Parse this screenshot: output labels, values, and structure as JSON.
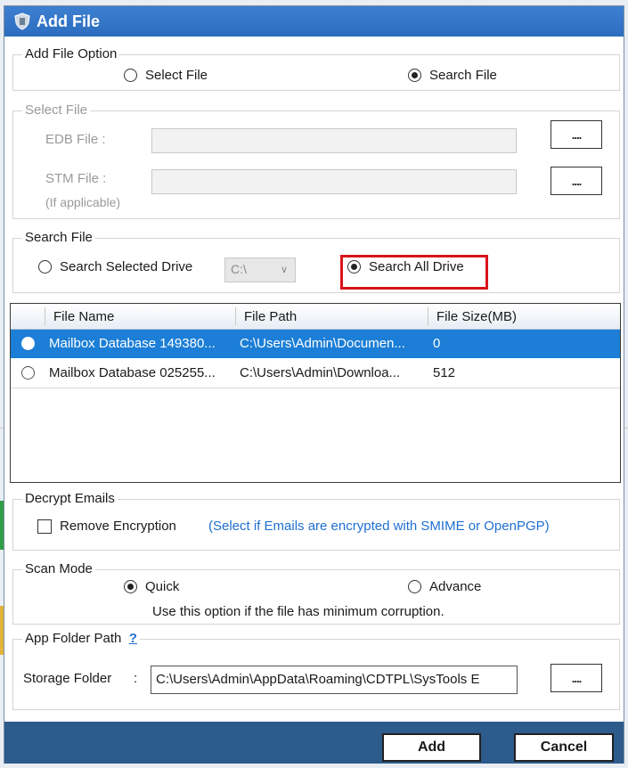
{
  "dialog": {
    "title": "Add File",
    "colors": {
      "titlebar": "#2c6dbf",
      "footer": "#2d5b8c",
      "selection": "#1c7ed6",
      "highlight": "#d9141b",
      "hint": "#1f6fd1"
    }
  },
  "add_file_option": {
    "title": "Add File Option",
    "options": [
      {
        "label": "Select File",
        "selected": false
      },
      {
        "label": "Search File",
        "selected": true
      }
    ]
  },
  "select_file": {
    "title": "Select File",
    "edb_label": "EDB File :",
    "stm_label": "STM File :",
    "stm_note": "(If applicable)",
    "browse_label": "...."
  },
  "search_file": {
    "title": "Search File",
    "selected_drive_label": "Search Selected Drive",
    "drive_value": "C:\\",
    "all_drive_label": "Search All Drive",
    "selected_mode": "all"
  },
  "file_grid": {
    "columns": [
      "File Name",
      "File Path",
      "File Size(MB)"
    ],
    "rows": [
      {
        "name": "Mailbox Database 149380...",
        "path": "C:\\Users\\Admin\\Documen...",
        "size": "0",
        "selected": true
      },
      {
        "name": "Mailbox Database 025255...",
        "path": "C:\\Users\\Admin\\Downloa...",
        "size": "512",
        "selected": false
      }
    ]
  },
  "decrypt": {
    "title": "Decrypt Emails",
    "checkbox_label": "Remove Encryption",
    "hint": "(Select if Emails are encrypted with SMIME or OpenPGP)",
    "checked": false
  },
  "scan_mode": {
    "title": "Scan Mode",
    "options": [
      {
        "label": "Quick",
        "selected": true
      },
      {
        "label": "Advance",
        "selected": false
      }
    ],
    "note": "Use this option if the file has minimum corruption."
  },
  "app_folder": {
    "title": "App Folder Path",
    "help": "?",
    "storage_label": "Storage Folder",
    "colon": ":",
    "path": "C:\\Users\\Admin\\AppData\\Roaming\\CDTPL\\SysTools E",
    "browse_label": "...."
  },
  "footer": {
    "add_label": "Add",
    "cancel_label": "Cancel"
  }
}
